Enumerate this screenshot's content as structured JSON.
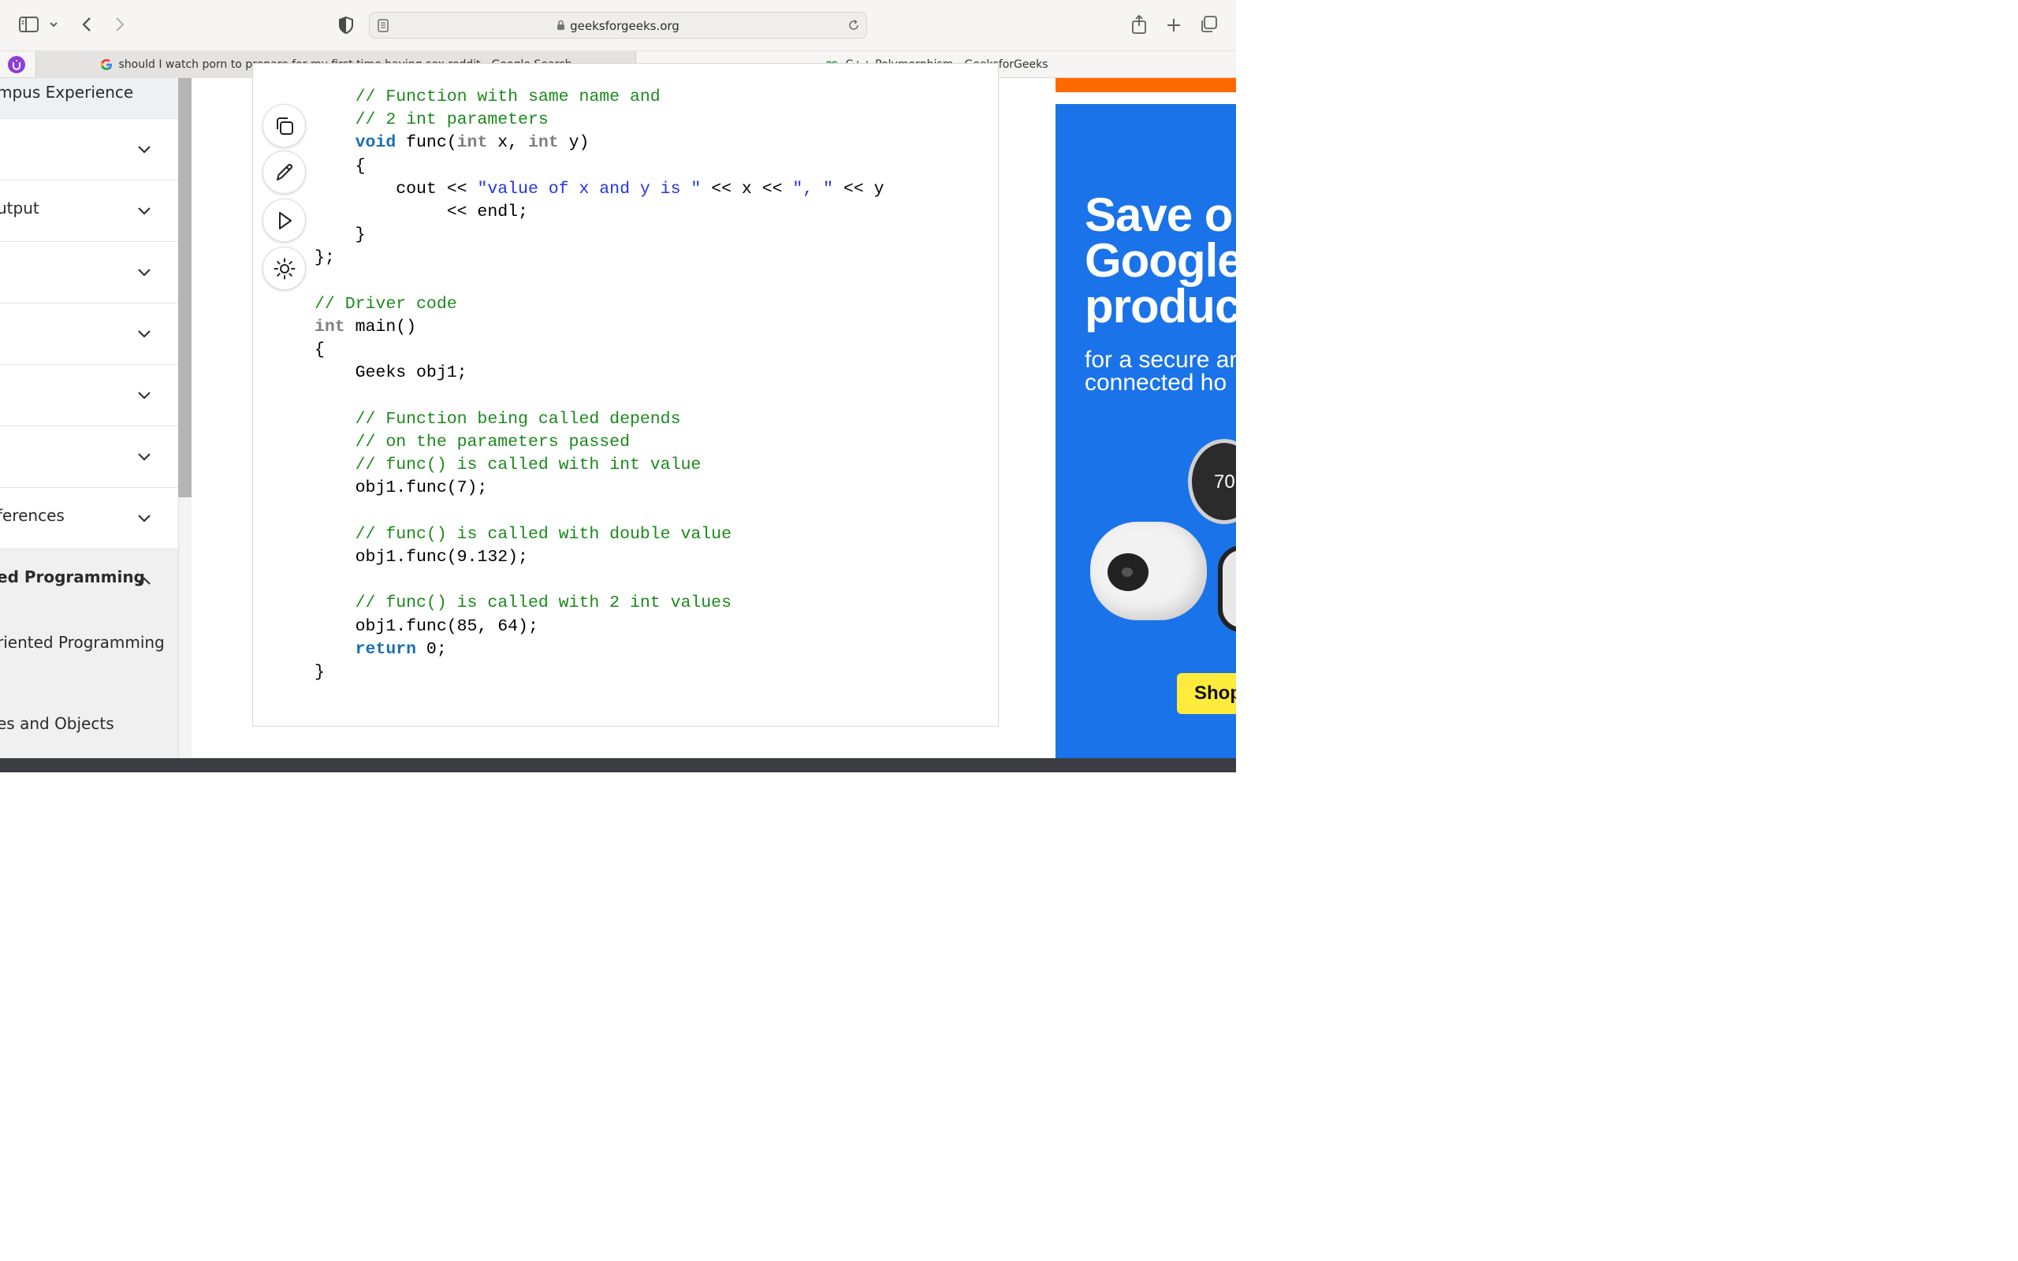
{
  "browser": {
    "url": "geeksforgeeks.org",
    "tabs": [
      {
        "title": "should I watch porn to prepare for my first time having sex reddit - Google Search",
        "favicon": "G"
      },
      {
        "title": "C++ Polymorphism - GeeksforGeeks",
        "favicon": "GfG"
      }
    ]
  },
  "sidebar": {
    "items": [
      {
        "label": "mpus Experience",
        "expanded": null
      },
      {
        "label": "",
        "expanded": false
      },
      {
        "label": "utput",
        "expanded": false
      },
      {
        "label": "",
        "expanded": false
      },
      {
        "label": "",
        "expanded": false
      },
      {
        "label": "",
        "expanded": false
      },
      {
        "label": "",
        "expanded": false
      },
      {
        "label": "ferences",
        "expanded": false
      },
      {
        "label": "ed Programming",
        "expanded": true
      },
      {
        "label": "riented Programming",
        "expanded": null
      },
      {
        "label": "es and Objects",
        "expanded": null
      }
    ]
  },
  "code": {
    "lines": [
      "    // Function with same name and",
      "    // 2 int parameters",
      "    void func(int x, int y)",
      "    {",
      "        cout << \"value of x and y is \" << x << \", \" << y",
      "             << endl;",
      "    }",
      "};",
      "",
      "// Driver code",
      "int main()",
      "{",
      "    Geeks obj1;",
      "",
      "    // Function being called depends",
      "    // on the parameters passed",
      "    // func() is called with int value",
      "    obj1.func(7);",
      "",
      "    // func() is called with double value",
      "    obj1.func(9.132);",
      "",
      "    // func() is called with 2 int values",
      "    obj1.func(85, 64);",
      "    return 0;",
      "}"
    ]
  },
  "code_tools": [
    "copy-icon",
    "edit-icon",
    "run-icon",
    "theme-icon"
  ],
  "ad": {
    "headline": "Save o\nGoogle\nproduc",
    "sub": "for a secure ar\nconnected ho",
    "button": "Shop",
    "display_temp": "70"
  },
  "colors": {
    "comment": "#1b8a1b",
    "keyword": "#1e6fb0",
    "string": "#2535e0",
    "ad_blue": "#1a73e8"
  }
}
